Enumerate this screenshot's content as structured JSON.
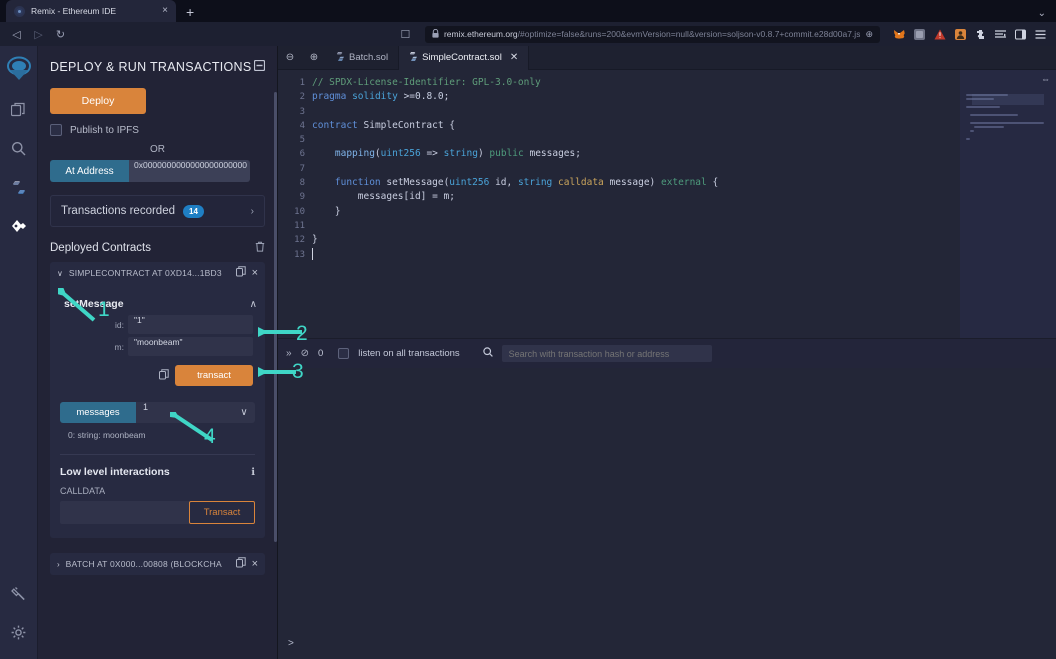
{
  "browser": {
    "tab_title": "Remix - Ethereum IDE",
    "tab_close": "×",
    "new_tab": "+",
    "back_icon": "◁",
    "forward_icon": "▷",
    "reload_icon": "↻",
    "bookmark_icon": "☐",
    "lock_icon": "🔒",
    "url_domain": "remix.ethereum.org",
    "url_path": "/#optimize=false&runs=200&evmVersion=null&version=soljson-v0.8.7+commit.e28d00a7.js",
    "url_zoom_icon": "⊕",
    "metamask_icon": "metamask-fox-icon",
    "warning_icon": "▲",
    "toolbar_icons": [
      "account-icon",
      "extensions-icon",
      "reading-list-icon",
      "sidebar-icon",
      "menu-icon"
    ],
    "list_all_tabs_icon": "⌄"
  },
  "rail": {
    "items": [
      {
        "name": "remix-logo",
        "glyph": ""
      },
      {
        "name": "file-explorer",
        "glyph": "❐"
      },
      {
        "name": "search-in-files",
        "glyph": "⚲"
      },
      {
        "name": "solidity-compiler",
        "glyph": "⎇"
      },
      {
        "name": "deploy-and-run",
        "glyph": "❖"
      }
    ],
    "bottom": [
      {
        "name": "plugin-manager",
        "glyph": "⚡"
      },
      {
        "name": "settings",
        "glyph": "⚙"
      }
    ]
  },
  "panel": {
    "title": "DEPLOY & RUN TRANSACTIONS",
    "header_icon": "☰",
    "deploy_label": "Deploy",
    "publish_ipfs_label": "Publish to IPFS",
    "or_label": "OR",
    "at_address_label": "At Address",
    "at_address_value": "0x0000000000000000000000",
    "transactions_recorded_label": "Transactions recorded",
    "transactions_recorded_count": "14",
    "chevron_right": "›",
    "deployed_contracts_label": "Deployed Contracts",
    "trash_icon": "🗑",
    "contract": {
      "caret": "∨",
      "name": "SIMPLECONTRACT AT 0XD14...1BD3",
      "copy_icon": "❐",
      "close_icon": "×",
      "function_name": "setMessage",
      "caret_up": "∧",
      "params": [
        {
          "label": "id:",
          "value": "\"1\""
        },
        {
          "label": "m:",
          "value": "\"moonbeam\""
        }
      ],
      "transact_label": "transact",
      "copy_calldata_icon": "❐",
      "getter_label": "messages",
      "getter_value": "1",
      "getter_caret": "∨",
      "getter_result": "0: string: moonbeam"
    },
    "low_level": {
      "title": "Low level interactions",
      "info_icon": "ℹ",
      "calldata_label": "CALLDATA",
      "calldata_value": "",
      "transact_label": "Transact"
    },
    "batch": {
      "caret": "›",
      "name": "BATCH AT 0X000...00808 (BLOCKCHA",
      "copy_icon": "❐",
      "close_icon": "×"
    }
  },
  "editor": {
    "zoom_out_icon": "⊖",
    "zoom_in_icon": "⊕",
    "tabs": [
      {
        "label": "Batch.sol",
        "active": false,
        "icon": "solidity-file-icon",
        "closable": false
      },
      {
        "label": "SimpleContract.sol",
        "active": true,
        "icon": "solidity-file-icon",
        "closable": true
      }
    ],
    "tab_close_icon": "✕",
    "minimap_collapse_icon": "⇔",
    "line_numbers": [
      "1",
      "2",
      "3",
      "4",
      "5",
      "6",
      "7",
      "8",
      "9",
      "10",
      "11",
      "12",
      "13"
    ],
    "code_lines": [
      "// SPDX-License-Identifier: GPL-3.0-only",
      "pragma solidity >=0.8.0;",
      "",
      "contract SimpleContract {",
      "",
      "    mapping(uint256 => string) public messages;",
      "",
      "    function setMessage(uint256 id, string calldata message) external {",
      "        messages[id] = m;",
      "    }",
      "",
      "}",
      ""
    ]
  },
  "statusbar": {
    "collapse_icon": "»",
    "clear_icon": "⊘",
    "count": "0",
    "listen_label": "listen on all transactions",
    "search_icon": "⚲",
    "search_placeholder": "Search with transaction hash or address"
  },
  "terminal": {
    "prompt": ">"
  },
  "annotations": [
    {
      "number": "1",
      "target": "contract-collapse-caret"
    },
    {
      "number": "2",
      "target": "function-collapse-caret"
    },
    {
      "number": "3",
      "target": "terminal-collapse-icon"
    },
    {
      "number": "4",
      "target": "copy-calldata-icon"
    }
  ],
  "colors": {
    "accent_orange": "#d9843b",
    "accent_blue": "#2f6c8d",
    "badge_blue": "#1f7fc4",
    "annotation_teal": "#3fd6c6",
    "panel_bg": "#222336",
    "editor_bg": "#232637"
  }
}
